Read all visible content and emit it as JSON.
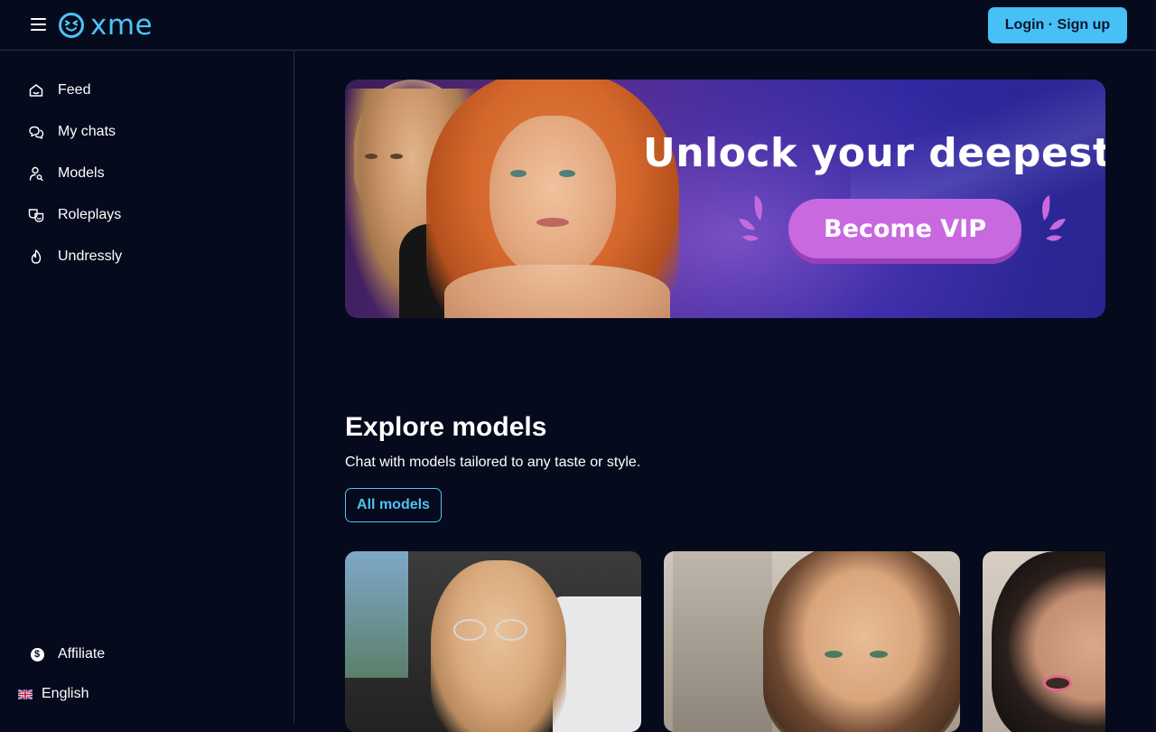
{
  "header": {
    "brand": "xme",
    "menu_icon": "hamburger-menu-icon",
    "login_label": "Login · Sign up",
    "accent_color": "#46c0f5"
  },
  "sidebar": {
    "items": [
      {
        "label": "Feed",
        "icon": "home-icon"
      },
      {
        "label": "My chats",
        "icon": "chat-bubbles-icon"
      },
      {
        "label": "Models",
        "icon": "user-search-icon"
      },
      {
        "label": "Roleplays",
        "icon": "masks-icon"
      },
      {
        "label": "Undressly",
        "icon": "flame-icon"
      }
    ],
    "footer": [
      {
        "label": "Affiliate",
        "icon": "dollar-circle-icon"
      },
      {
        "label": "English",
        "icon": "uk-flag-icon"
      }
    ]
  },
  "banner": {
    "headline": "Unlock your deepest desi",
    "cta_label": "Become VIP"
  },
  "explore": {
    "title": "Explore models",
    "subtitle": "Chat with models tailored to any taste or style.",
    "all_models_label": "All models",
    "cards": [
      {
        "name": "model-card-1"
      },
      {
        "name": "model-card-2"
      },
      {
        "name": "model-card-3"
      }
    ]
  },
  "colors": {
    "background": "#050a1c",
    "divider": "#2a3042",
    "vip_button": "#c869e0"
  }
}
